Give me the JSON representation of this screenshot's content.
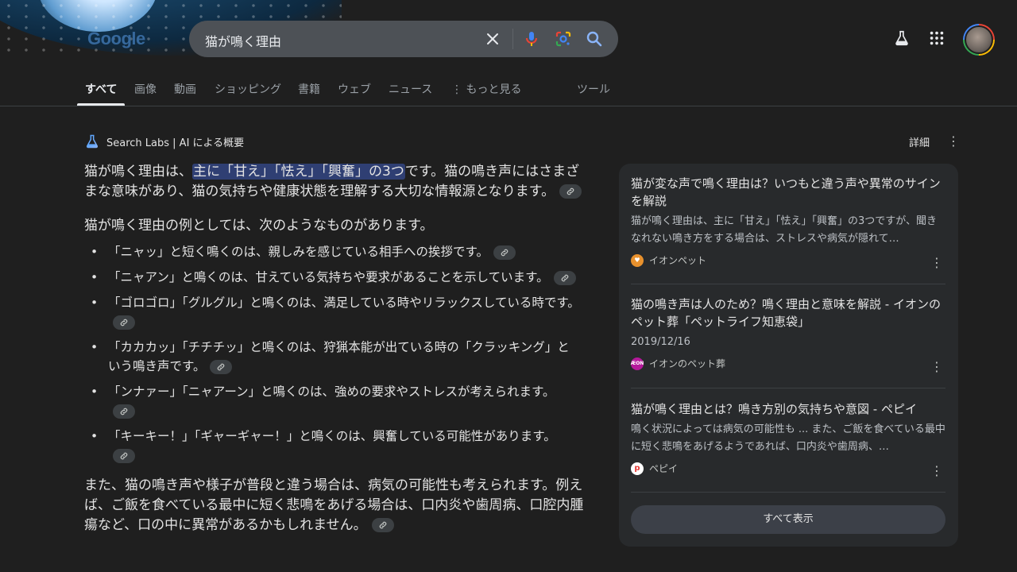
{
  "logo": "Google",
  "search": {
    "query": "猫が鳴く理由"
  },
  "tabs": [
    {
      "label": "すべて",
      "active": true
    },
    {
      "label": "画像"
    },
    {
      "label": "動画"
    },
    {
      "label": "ショッピング"
    },
    {
      "label": "書籍"
    },
    {
      "label": "ウェブ"
    },
    {
      "label": "ニュース"
    },
    {
      "label": "もっと見る"
    },
    {
      "label": "ツール"
    }
  ],
  "ai_overview": {
    "header": "Search Labs | AI による概要",
    "details_label": "詳細",
    "para1_pre": "猫が鳴く理由は、",
    "para1_highlight": "主に「甘え」「怯え」「興奮」の3つ",
    "para1_post": "です。猫の鳴き声にはさまざまな意味があり、猫の気持ちや健康状態を理解する大切な情報源となります。",
    "para2": "猫が鳴く理由の例としては、次のようなものがあります。",
    "bullets": [
      "「ニャッ」と短く鳴くのは、親しみを感じている相手への挨拶です。",
      "「ニャアン」と鳴くのは、甘えている気持ちや要求があることを示しています。",
      "「ゴロゴロ」「グルグル」と鳴くのは、満足している時やリラックスしている時です。",
      "「カカカッ」「チチチッ」と鳴くのは、狩猟本能が出ている時の「クラッキング」という鳴き声です。",
      "「ンナァー」「ニャアーン」と鳴くのは、強めの要求やストレスが考えられます。",
      "「キーキー！」「ギャーギャー！」と鳴くのは、興奮している可能性があります。"
    ],
    "para3": "また、猫の鳴き声や様子が普段と違う場合は、病気の可能性も考えられます。例えば、ご飯を食べている最中に短く悲鳴をあげる場合は、口内炎や歯周病、口腔内腫瘍など、口の中に異常があるかもしれません。"
  },
  "sources": [
    {
      "title": "猫が変な声で鳴く理由は？いつもと違う声や異常のサインを解説",
      "snippet": "猫が鳴く理由は、主に「甘え」「怯え」「興奮」の3つですが、聞きなれない鳴き方をする場合は、ストレスや病気が隠れて…",
      "source": "イオンペット",
      "favicon_color": "#e8912d"
    },
    {
      "title": "猫の鳴き声は人のため？鳴く理由と意味を解説 - イオンのペット葬「ペットライフ知恵袋」",
      "snippet": "2019/12/16",
      "source": "イオンのペット葬",
      "favicon_color": "#b5199b",
      "favicon_text": "ÆON"
    },
    {
      "title": "猫が鳴く理由とは？鳴き方別の気持ちや意図 - ペピイ",
      "snippet": "鳴く状況によっては病気の可能性も ... また、ご飯を食べている最中に短く悲鳴をあげるようであれば、口内炎や歯周病、…",
      "source": "ペピイ",
      "favicon_color": "#e53935",
      "favicon_text": "p"
    }
  ],
  "show_all_label": "すべて表示",
  "colors": {
    "background": "#1f1f1f",
    "panel": "#282a2c",
    "highlight": "#2f3f73",
    "search_bar": "#4d5156"
  }
}
